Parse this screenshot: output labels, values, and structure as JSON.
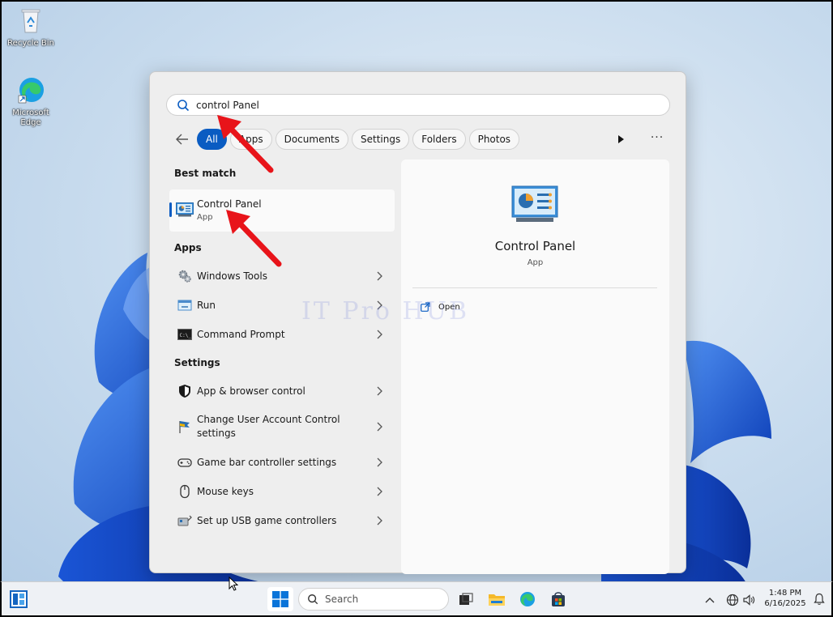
{
  "desktop": {
    "icons": [
      {
        "label": "Recycle Bin",
        "icon": "recycle-bin-icon"
      },
      {
        "label": "Microsoft Edge",
        "icon": "edge-shortcut-icon"
      }
    ],
    "watermark": "IT Pro HUB"
  },
  "search": {
    "value": "control Panel",
    "icon": "search-icon"
  },
  "filters": {
    "back_icon": "back-arrow-icon",
    "chips": [
      "All",
      "Apps",
      "Documents",
      "Settings",
      "Folders",
      "Photos"
    ],
    "active": "All",
    "play_icon": "play-icon",
    "more_label": "···"
  },
  "best_match": {
    "title": "Best match",
    "item": {
      "name": "Control Panel",
      "type": "App",
      "icon": "control-panel-icon"
    }
  },
  "apps": {
    "title": "Apps",
    "items": [
      {
        "label": "Windows Tools",
        "icon": "gears-icon"
      },
      {
        "label": "Run",
        "icon": "run-icon"
      },
      {
        "label": "Command Prompt",
        "icon": "terminal-icon"
      }
    ]
  },
  "settings": {
    "title": "Settings",
    "items": [
      {
        "label": "App & browser control",
        "icon": "shield-icon"
      },
      {
        "label": "Change User Account Control settings",
        "icon": "uac-flag-icon"
      },
      {
        "label": "Game bar controller settings",
        "icon": "gamepad-icon"
      },
      {
        "label": "Mouse keys",
        "icon": "mouse-icon"
      },
      {
        "label": "Set up USB game controllers",
        "icon": "usb-controller-icon"
      }
    ]
  },
  "detail": {
    "name": "Control Panel",
    "type": "App",
    "open_label": "Open",
    "icon": "control-panel-large-icon"
  },
  "taskbar": {
    "search_label": "Search",
    "apps": [
      "task-view-icon",
      "file-explorer-icon",
      "edge-icon",
      "store-icon"
    ],
    "time": "1:48 PM",
    "date": "6/16/2025"
  },
  "colors": {
    "accent": "#0a5cc2",
    "arrow": "#e8141a",
    "panel_bg": "#eeeeee"
  }
}
